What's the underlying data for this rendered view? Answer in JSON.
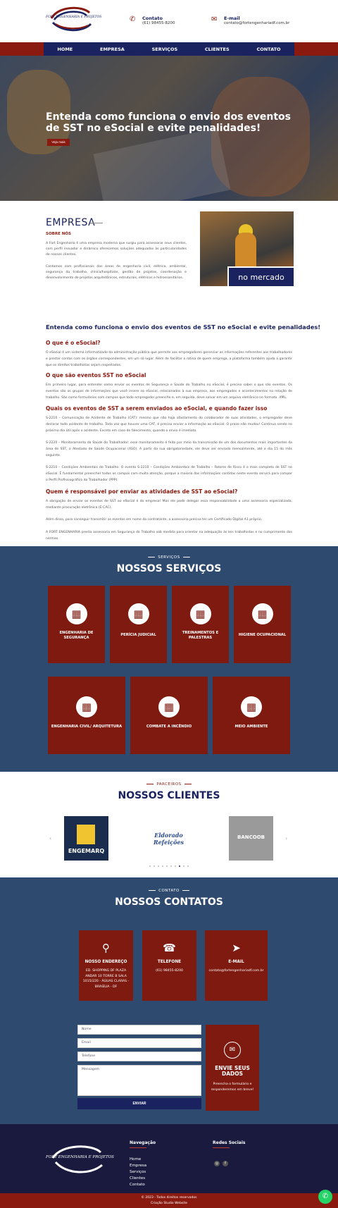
{
  "brand": {
    "logo_text": "FORT ENGENHARIA E PROJETOS"
  },
  "header": {
    "contact_label": "Contato",
    "contact_value": "(61) 98455-8200",
    "email_label": "E-mail",
    "email_value": "contato@fortengenhariadf.com.br"
  },
  "nav": {
    "items": [
      "HOME",
      "EMPRESA",
      "SERVIÇOS",
      "CLIENTES",
      "CONTATO"
    ]
  },
  "hero": {
    "title": "Entenda como funciona o envio dos eventos de SST no eSocial e evite penalidades!",
    "button": "Veja mais"
  },
  "empresa": {
    "title": "EMPRESA",
    "subtitle": "SOBRE NÓS",
    "p1": "A Fort Engenharia é uma empresa moderna que surgiu para assessorar seus clientes, com perfil inovador e dinâmico oferecemos soluções adequadas às particularidades de nossos clientes.",
    "p2": "Contamos com profissionais das áreas de engenharia civil, elétrica, ambiental, segurança do trabalho, clínica/hospitalar, gestão de projetos, coordenação e desenvolvimento de projetos arquitetônicos, estruturais, elétricos e hidrossanitários.",
    "image_tag": "no mercado"
  },
  "article": {
    "title": "Entenda como funciona o envio dos eventos de SST no eSocial e evite penalidades!",
    "q1": "O que é o eSocial?",
    "a1": "O eSocial é um sistema informatizado da administração pública que permite aos empregadores gerenciar as informações referentes aos trabalhadores e prestar contas com os órgãos correspondentes, em um só lugar. Além de facilitar a rotina de quem emprega, a plataforma também ajuda a garantir que os direitos trabalhistas sejam respeitados.",
    "q2": "O que são eventos SST no eSocial",
    "a2": "Em primeiro lugar, para entender como enviar os eventos de Segurança e Saúde do Trabalho no eSocial, é preciso saber o que são eventos. Os eventos são os grupos de informações que você insere no eSocial, relacionados à sua empresa, aos empregados e acontecimentos na relação de trabalho. São como formulários com campos que todo empregador preenche e, em seguida, deve salvar em um arquivo eletrônico no formato .XML.",
    "q3": "Quais os eventos de SST a serem enviados ao eSocial, e quando fazer isso",
    "a3a": "S-2210 – Comunicação de Acidente de Trabalho (CAT): mesmo que não haja afastamento do colaborador de suas atividades, o empregador deve declarar todo acidente de trabalho. Toda vez que houver uma CAT, é preciso enviar a informação ao eSocial. O prazo não mudou! Continua sendo no próximo dia útil após o acidente. Exceto em caso de falecimento, quando o envio é imediato.",
    "a3b": "S-2220 – Monitoramento da Saúde do Trabalhador: esse monitoramento é feito por meio da transmissão de um dos documentos mais importantes da área de SST, o Atestado de Saúde Ocupacional (ASO). A partir da sua obrigatoriedade, ele deve ser enviado mensalmente, até o dia 15 do mês seguinte.",
    "a3c": "S-2210 – Condições Ambientais do Trabalho: O evento S-2210 – Condições Ambientais de Trabalho – Fatores de Risco é o mais completo de SST no eSocial. É fundamental preencher todos os campos com muita atenção, porque a maioria das informações contidas neste evento servirá para compor o Perfil Profissiográfico do Trabalhador (PPP).",
    "q4": "Quem é responsável por enviar as atividades de SST ao eSocial?",
    "a4a": "A obrigação de enviar os eventos de SST ao eSocial é do empresa! Mas ele pode delegar essa responsabilidade a uma assessoria especializada, mediante procuração eletrônica (E-CAC).",
    "a4b": "Além disso, para conseguir transmitir os eventos em nome da contratante, a assessoria precisa ter um Certificado Digital A1 próprio.",
    "a4c": "A FORT ENGENHARIA presta assessoria em Segurança do Trabalho sob medida para orientar na adequação às leis trabalhistas e no cumprimento das normas."
  },
  "services": {
    "kicker": "SERVIÇOS",
    "title": "NOSSOS SERVIÇOS",
    "items": [
      "ENGENHARIA DE SEGURANÇA",
      "PERÍCIA JUDICIAL",
      "TREINAMENTOS E PALESTRAS",
      "HIGIENE OCUPACIONAL",
      "ENGENHARIA CIVIL/ ARQUITETURA",
      "COMBATE A INCÊNDIO",
      "MEIO AMBIENTE"
    ]
  },
  "clients": {
    "kicker": "PARCEIROS",
    "title": "NOSSOS CLIENTES",
    "logos": [
      "ENGEMARQ",
      "Eldorado Refeições",
      "BANCOOB"
    ],
    "prev": "‹",
    "next": "›"
  },
  "contacts": {
    "kicker": "CONTATO",
    "title": "NOSSOS CONTATOS",
    "cards": [
      {
        "title": "NOSSO ENDEREÇO",
        "value": "ED. SHOPPING DF PLAZA ANDAR 10 TORRE B SALA 1015/220 - ÁGUAS CLARAS - BRASÍLIA - DF"
      },
      {
        "title": "TELEFONE",
        "value": "(61) 98455-8200"
      },
      {
        "title": "E-MAIL",
        "value": "contato@fortengenhariadf.com.br"
      }
    ],
    "form": {
      "name": "Nome",
      "email": "Email",
      "phone": "Telefone",
      "message": "Mensagem",
      "submit": "ENVIAR"
    },
    "side": {
      "title": "ENVIE SEUS DADOS",
      "text": "Preencha o formulário e responderemos em breve!"
    }
  },
  "footer": {
    "nav_title": "Navegação",
    "nav_items": [
      "Home",
      "Empresa",
      "Serviços",
      "Clientes",
      "Contato"
    ],
    "social_title": "Redes Sociais",
    "copyright": "© 2023 - Todos direitos reservados",
    "credit": "Criação Studio Website"
  },
  "colors": {
    "primary": "#1a2260",
    "accent": "#8a1a10",
    "section": "#2e4a6e",
    "whatsapp": "#25d366"
  }
}
